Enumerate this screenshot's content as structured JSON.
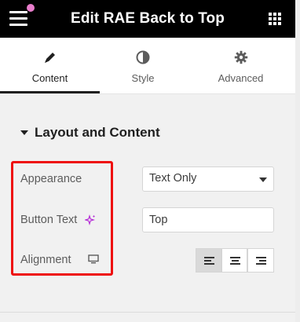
{
  "header": {
    "title": "Edit RAE Back to Top",
    "menu_icon": "hamburger-menu-icon",
    "apps_icon": "grid-apps-icon",
    "notification_dot_color": "#e87dcb"
  },
  "tabs": [
    {
      "label": "Content",
      "icon": "pencil-icon",
      "active": true
    },
    {
      "label": "Style",
      "icon": "half-circle-icon",
      "active": false
    },
    {
      "label": "Advanced",
      "icon": "gear-icon",
      "active": false
    }
  ],
  "section": {
    "title": "Layout and Content",
    "expanded": true
  },
  "controls": {
    "appearance": {
      "label": "Appearance",
      "value": "Text Only"
    },
    "button_text": {
      "label": "Button Text",
      "value": "Top",
      "ai_icon": "sparkle-ai-icon"
    },
    "alignment": {
      "label": "Alignment",
      "device_icon": "desktop-icon",
      "options": [
        "left",
        "center",
        "right"
      ],
      "selected": "left"
    }
  },
  "highlight_color": "#ee0e0e"
}
